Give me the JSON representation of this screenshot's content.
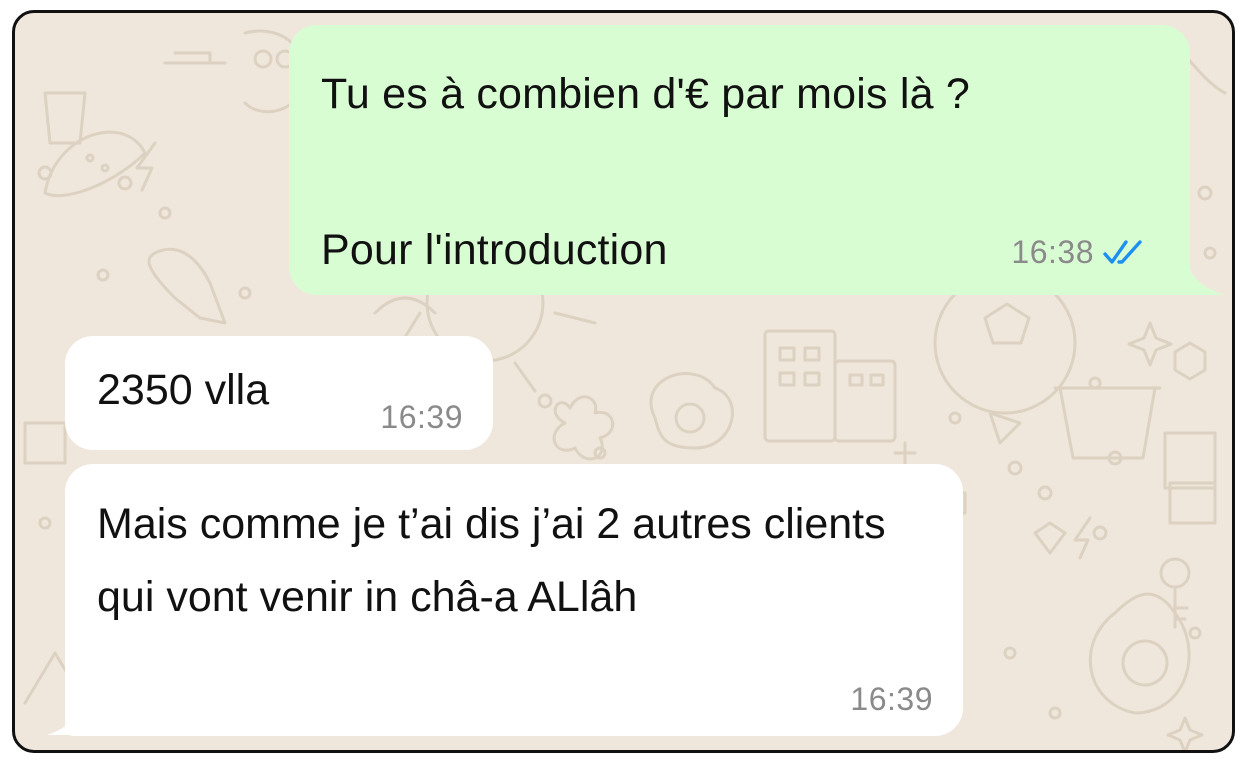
{
  "chat": {
    "messages": [
      {
        "direction": "outgoing",
        "text": "Tu es à combien d'€ par mois là ?\n\nPour l'introduction",
        "time": "16:38",
        "status": "read",
        "status_icon": "double-check-icon",
        "status_color": "#1d8ff0"
      },
      {
        "direction": "incoming",
        "text": "2350 vlla",
        "time": "16:39"
      },
      {
        "direction": "incoming",
        "text": "Mais comme je t’ai dis j’ai 2 autres clients qui vont venir in châ-a ALlâh",
        "time": "16:39"
      }
    ]
  },
  "colors": {
    "wallpaper": "#efe7dc",
    "wallpaper_doodle": "#ddd2c1",
    "outgoing_bubble": "#d9fdd3",
    "incoming_bubble": "#ffffff",
    "timestamp": "#8a8a8a",
    "frame_border": "#111111"
  }
}
